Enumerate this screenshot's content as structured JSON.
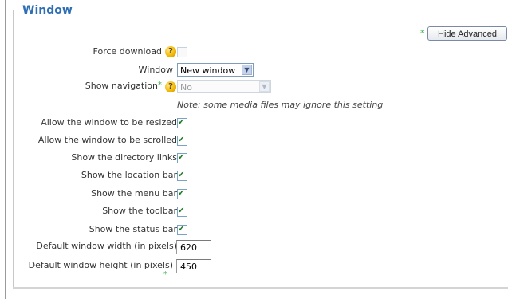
{
  "section": {
    "legend": "Window"
  },
  "advanced_button": {
    "label": "Hide Advanced",
    "star": "*"
  },
  "fields": {
    "force_download": {
      "label": "Force download",
      "help": "?"
    },
    "window": {
      "label": "Window",
      "value": "New window"
    },
    "show_navigation": {
      "label": "Show navigation",
      "star": "*",
      "help": "?",
      "value": "No",
      "note": "Note: some media files may ignore this setting"
    },
    "resizable": {
      "label": "Allow the window to be resized",
      "star": "*"
    },
    "scrollbars": {
      "label": "Allow the window to be scrolled",
      "star": "*"
    },
    "directories": {
      "label": "Show the directory links",
      "star": "*"
    },
    "location": {
      "label": "Show the location bar",
      "star": "*"
    },
    "menubar": {
      "label": "Show the menu bar",
      "star": "*"
    },
    "toolbar": {
      "label": "Show the toolbar",
      "star": "*"
    },
    "status": {
      "label": "Show the status bar",
      "star": "*"
    },
    "width": {
      "label": "Default window width (in pixels)",
      "star": "*",
      "value": "620"
    },
    "height": {
      "label": "Default window height (in pixels)",
      "star": "*",
      "value": "450"
    }
  },
  "colors": {
    "legend": "#2f6fb5",
    "advanced_star": "#3cb44b",
    "help_icon": "#f0b400"
  }
}
